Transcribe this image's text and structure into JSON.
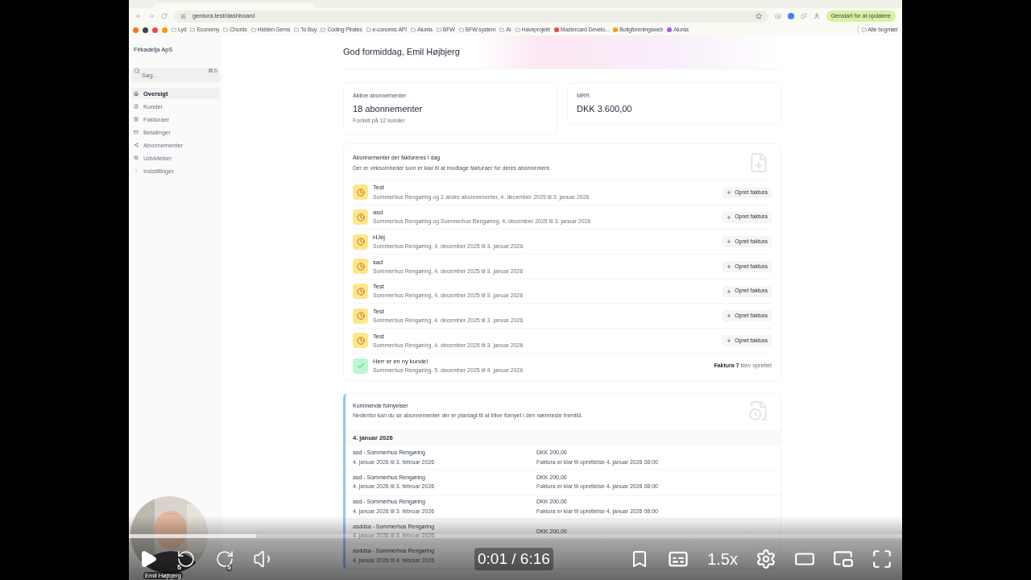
{
  "browser": {
    "url": "gentura.test/dashboard",
    "update_button": "Genstart for at opdatere",
    "all_bookmarks": "Alle bogmær",
    "favicons": [
      {
        "color": "#f97316"
      },
      {
        "color": "#374151"
      },
      {
        "color": "#ef4444"
      },
      {
        "color": "#f59e0b"
      }
    ],
    "bookmarks": [
      {
        "label": "Lyd",
        "kind": "folder"
      },
      {
        "label": "Economy",
        "kind": "folder"
      },
      {
        "label": "Chords",
        "kind": "folder"
      },
      {
        "label": "Hidden Gems",
        "kind": "folder"
      },
      {
        "label": "To Buy",
        "kind": "folder"
      },
      {
        "label": "Coding Pirates",
        "kind": "folder"
      },
      {
        "label": "e-conomic API",
        "kind": "folder"
      },
      {
        "label": "Alunta",
        "kind": "folder"
      },
      {
        "label": "BFW",
        "kind": "folder"
      },
      {
        "label": "BFW system",
        "kind": "folder"
      },
      {
        "label": "AI",
        "kind": "folder"
      },
      {
        "label": "Haveprojekt",
        "kind": "folder"
      },
      {
        "label": "Mastercard Develo...",
        "kind": "site",
        "color": "#ef4444"
      },
      {
        "label": "Boligforeningsweb",
        "kind": "site",
        "color": "#f59e0b"
      },
      {
        "label": "Alunta",
        "kind": "site",
        "color": "#a855f7"
      }
    ]
  },
  "sidebar": {
    "company": "Firkadelja ApS",
    "search": {
      "placeholder": "Søg...",
      "shortcut": "⌘S"
    },
    "items": [
      {
        "label": "Oversigt",
        "selected": true
      },
      {
        "label": "Kunder",
        "selected": false
      },
      {
        "label": "Fakturaer",
        "selected": false
      },
      {
        "label": "Betalinger",
        "selected": false
      },
      {
        "label": "Abonnementer",
        "selected": false
      },
      {
        "label": "Udvidelser",
        "selected": false
      },
      {
        "label": "Indstillinger",
        "selected": false
      }
    ],
    "user": "Emil Højbjerg"
  },
  "greeting": "God formiddag, Emil Højbjerg",
  "stats": [
    {
      "label": "Aktive abonnementer",
      "value": "18 abonnementer",
      "note": "Fordelt på 12 kunder"
    },
    {
      "label": "MRR",
      "value": "DKK 3.600,00"
    }
  ],
  "invoice_today": {
    "title": "Abonnementer der faktureres i dag",
    "subtitle": "Der er virksomheder som er klar til at modtage fakturaer for deres abonnement.",
    "rows": [
      {
        "name": "Test",
        "detail": "Sommerhus Rengøring og 2 andre abonnementer, 4. december 2025 til 3. januar 2026",
        "done": false,
        "action": "Opret faktura"
      },
      {
        "name": "asd",
        "detail": "Sommerhus Rengøring og Sommerhus Rengøring, 4. december 2025 til 3. januar 2026",
        "done": false,
        "action": "Opret faktura"
      },
      {
        "name": "HJej",
        "detail": "Sommerhus Rengøring, 4. december 2025 til 3. januar 2026",
        "done": false,
        "action": "Opret faktura"
      },
      {
        "name": "sad",
        "detail": "Sommerhus Rengøring, 4. december 2025 til 3. januar 2026",
        "done": false,
        "action": "Opret faktura"
      },
      {
        "name": "Test",
        "detail": "Sommerhus Rengøring, 4. december 2025 til 3. januar 2026",
        "done": false,
        "action": "Opret faktura"
      },
      {
        "name": "Test",
        "detail": "Sommerhus Rengøring, 4. december 2025 til 3. januar 2026",
        "done": false,
        "action": "Opret faktura"
      },
      {
        "name": "Test",
        "detail": "Sommerhus Rengøring, 4. december 2025 til 3. januar 2026",
        "done": false,
        "action": "Opret faktura"
      },
      {
        "name": "Herr er en ny kunde!",
        "detail": "Sommerhus Rengøring, 5. december 2025 til 4. januar 2026",
        "done": true,
        "result": "**Faktura 7** blev oprettet"
      }
    ]
  },
  "renewals": {
    "title": "Kommende fornyelser",
    "subtitle": "Nedenfor kan du se abonnementer der er planlagt til at blive fornyet i den nærmeste fremtid.",
    "date": "4. januar 2026",
    "rows": [
      {
        "name": "asd - Sommerhus Rengøring",
        "period": "4. januar 2026 til 3. februar 2026",
        "amount": "DKK 200,00",
        "note": "Faktura er klar til oprettelse 4. januar 2026 08:00"
      },
      {
        "name": "asd - Sommerhus Rengøring",
        "period": "4. januar 2026 til 3. februar 2026",
        "amount": "DKK 200,00",
        "note": "Faktura er klar til oprettelse 4. januar 2026 08:00"
      },
      {
        "name": "asd - Sommerhus Rengøring",
        "period": "4. januar 2026 til 3. februar 2026",
        "amount": "DKK 200,00",
        "note": "Faktura er klar til oprettelse 4. januar 2026 08:00"
      },
      {
        "name": "asddsa - Sommerhus Rengøring",
        "period": "4. januar 2026 til 3. februar 2026",
        "amount": "DKK 200,00"
      },
      {
        "name": "asddsa - Sommerhus Rengøring",
        "period": "4. januar 2026 til 4. februar 2026"
      }
    ]
  },
  "player": {
    "level": 0.165,
    "time": "0:01 / 6:16",
    "speed": "1.5x",
    "rewind_label": "5",
    "forward_label": "5"
  }
}
